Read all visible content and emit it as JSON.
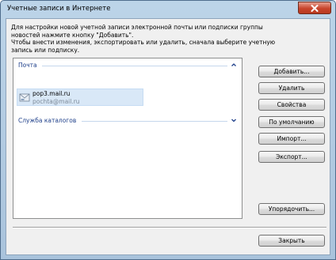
{
  "window": {
    "title": "Учетные записи в Интернете",
    "close_icon": "close-icon"
  },
  "description": {
    "line1": "Для настройки новой учетной записи электронной почты или подписки группы",
    "line2": "новостей нажмите кнопку \"Добавить\".",
    "line3": "Чтобы внести изменения, экспортировать или удалить, сначала выберите учетную",
    "line4": "запись или подписку."
  },
  "groups": {
    "mail": {
      "label": "Почта",
      "state": "expanded"
    },
    "directory": {
      "label": "Служба каталогов",
      "state": "collapsed"
    }
  },
  "account": {
    "server": "pop3.mail.ru",
    "email": "pochta@mail.ru",
    "icon": "mail-account-icon"
  },
  "buttons": {
    "add": "Добавить...",
    "remove": "Удалить",
    "properties": "Свойства",
    "default": "По умолчанию",
    "import": "Импорт...",
    "export": "Экспорт...",
    "order": "Упорядочить...",
    "close": "Закрыть"
  },
  "colors": {
    "selection": "#d9e8f7",
    "group_text": "#1e3f8a",
    "close_red": "#c8442c"
  }
}
